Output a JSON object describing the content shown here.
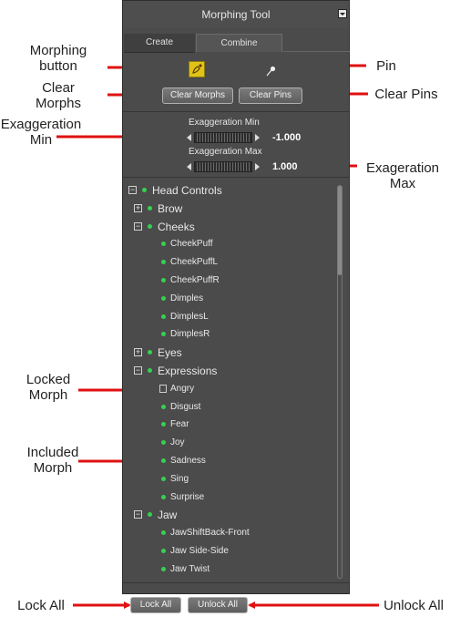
{
  "panel": {
    "title": "Morphing Tool",
    "tabs": [
      "Create",
      "Combine"
    ],
    "buttons": {
      "clear_morphs": "Clear Morphs",
      "clear_pins": "Clear Pins"
    },
    "exaggeration": {
      "min_label": "Exaggeration Min",
      "min_value": "-1.000",
      "max_label": "Exaggeration Max",
      "max_value": "1.000"
    },
    "tree": [
      {
        "label": "Head Controls",
        "kind": "group",
        "expander": "−"
      },
      {
        "label": "Brow",
        "kind": "group",
        "expander": "+"
      },
      {
        "label": "Cheeks",
        "kind": "group",
        "expander": "−"
      },
      {
        "label": "CheekPuff",
        "kind": "morph"
      },
      {
        "label": "CheekPuffL",
        "kind": "morph"
      },
      {
        "label": "CheekPuffR",
        "kind": "morph"
      },
      {
        "label": "Dimples",
        "kind": "morph"
      },
      {
        "label": "DimplesL",
        "kind": "morph"
      },
      {
        "label": "DimplesR",
        "kind": "morph"
      },
      {
        "label": "Eyes",
        "kind": "group",
        "expander": "+"
      },
      {
        "label": "Expressions",
        "kind": "group",
        "expander": "−"
      },
      {
        "label": "Angry",
        "kind": "locked"
      },
      {
        "label": "Disgust",
        "kind": "morph"
      },
      {
        "label": "Fear",
        "kind": "morph"
      },
      {
        "label": "Joy",
        "kind": "morph"
      },
      {
        "label": "Sadness",
        "kind": "morph"
      },
      {
        "label": "Sing",
        "kind": "morph"
      },
      {
        "label": "Surprise",
        "kind": "morph"
      },
      {
        "label": "Jaw",
        "kind": "group",
        "expander": "−"
      },
      {
        "label": "JawShiftBack-Front",
        "kind": "morph"
      },
      {
        "label": "Jaw Side-Side",
        "kind": "morph"
      },
      {
        "label": "Jaw Twist",
        "kind": "morph"
      }
    ],
    "footer": {
      "lock_all": "Lock All",
      "unlock_all": "Unlock All"
    }
  },
  "annotations": {
    "morphing_button": "Morphing\nbutton",
    "clear_morphs": "Clear\nMorphs",
    "exaggeration_min": "Exaggeration\nMin",
    "pin": "Pin",
    "clear_pins": "Clear Pins",
    "exageration_max": "Exageration\nMax",
    "locked_morph": "Locked\nMorph",
    "included_morph": "Included\nMorph",
    "lock_all": "Lock All",
    "unlock_all": "Unlock All"
  },
  "colors": {
    "panel_bg": "#4b4b4b",
    "arrow": "#e01010",
    "morph_dot": "#34d24f",
    "morph_button": "#e1c318"
  }
}
